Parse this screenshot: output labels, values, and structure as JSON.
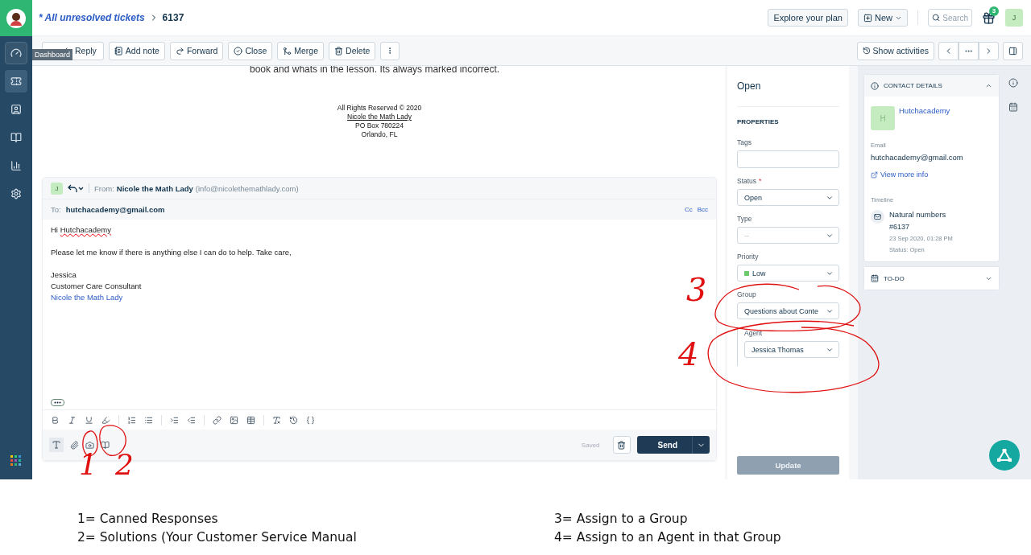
{
  "sidebar": {
    "items": [
      {
        "selected": false,
        "hovered": true
      },
      {
        "selected": true,
        "hovered": false
      },
      {
        "selected": false,
        "hovered": false
      },
      {
        "selected": false,
        "hovered": false
      },
      {
        "selected": false,
        "hovered": false
      },
      {
        "selected": false,
        "hovered": false
      }
    ],
    "tooltip": "Dashboard"
  },
  "header": {
    "breadcrumb": "* All unresolved tickets",
    "ticket": "6137",
    "plan_button": "Explore your plan",
    "new_button": "New",
    "search_placeholder": "Search",
    "gift_badge": "3",
    "avatar": "J"
  },
  "toolbar": {
    "actions": [
      {
        "kind": "reply",
        "label": "Reply"
      },
      {
        "kind": "note",
        "label": "Add note"
      },
      {
        "kind": "forward",
        "label": "Forward"
      },
      {
        "kind": "close",
        "label": "Close"
      },
      {
        "kind": "merge",
        "label": "Merge"
      },
      {
        "kind": "delete",
        "label": "Delete"
      }
    ],
    "activities": "Show activities"
  },
  "message": {
    "text": "book and whats in the lesson. Its always marked incorrect.",
    "footer": [
      {
        "text": "All Rights Reserved © 2020",
        "link": false
      },
      {
        "text": "Nicole the Math Lady",
        "link": true
      },
      {
        "text": "PO Box 780224",
        "link": false
      },
      {
        "text": "Orlando, FL",
        "link": false
      }
    ]
  },
  "reply": {
    "avatar": "J",
    "from_label": "From:",
    "from_name": "Nicole the Math Lady",
    "from_email": "(info@nicolethemathlady.com)",
    "to_label": "To:",
    "to": "hutchacademy@gmail.com",
    "cc": "Cc",
    "bcc": "Bcc",
    "body": [
      {
        "kind": "greeting",
        "text": "Hi",
        "name": "Hutchacademy"
      },
      {
        "kind": "gap"
      },
      {
        "kind": "line",
        "text": "Please let me know if there is anything else I can do to help.  Take care,"
      },
      {
        "kind": "gap"
      },
      {
        "kind": "line",
        "text": "Jessica"
      },
      {
        "kind": "line",
        "text": "Customer Care Consultant"
      },
      {
        "kind": "link",
        "text": "Nicole the Math Lady"
      }
    ],
    "saved": "Saved",
    "send": "Send"
  },
  "properties": {
    "status_title": "Open",
    "heading": "PROPERTIES",
    "fields": [
      {
        "kind": "text",
        "label": "Tags",
        "required": false
      },
      {
        "kind": "select",
        "label": "Status",
        "required": true,
        "required_mark": "*",
        "value": "Open"
      },
      {
        "kind": "select",
        "label": "Type",
        "required": false,
        "placeholder": "--"
      },
      {
        "kind": "select",
        "label": "Priority",
        "required": false,
        "value": "Low",
        "color": "#6cc96c"
      },
      {
        "kind": "select",
        "label": "Group",
        "required": false,
        "value": "Questions about Conte"
      },
      {
        "kind": "nested",
        "label": "Agent",
        "required": false,
        "value": "Jessica Thomas"
      }
    ],
    "update": {
      "label": "Update",
      "disabled": true
    }
  },
  "contact": {
    "heading": "CONTACT DETAILS",
    "expanded": true,
    "avatar": "H",
    "name": "Hutchacademy",
    "email_label": "Email",
    "email": "hutchacademy@gmail.com",
    "view_more": "View more info",
    "timeline_label": "Timeline",
    "timeline": [
      {
        "title": "Natural numbers",
        "id": "#6137",
        "date": "23 Sep 2020, 01:28 PM",
        "status": "Status: Open"
      }
    ]
  },
  "todo": {
    "heading": "TO-DO",
    "expanded": false
  },
  "annotations": {
    "marks": [
      "1",
      "2",
      "3",
      "4"
    ],
    "legend_left": [
      "1= Canned Responses",
      "2= Solutions (Your Customer Service Manual"
    ],
    "legend_right": [
      "3= Assign to a Group",
      "4= Assign to an Agent in that Group"
    ]
  }
}
